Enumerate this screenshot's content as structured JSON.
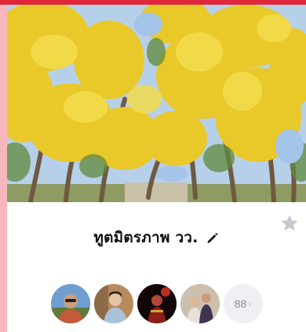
{
  "group": {
    "name": "ทูตมิตรภาพ วว."
  },
  "members": {
    "more_count": "88",
    "more_chevron": "›",
    "avatars": [
      {
        "icon": "member-avatar-man-sunglasses"
      },
      {
        "icon": "member-avatar-woman-indoor"
      },
      {
        "icon": "member-avatar-person-red-light"
      },
      {
        "icon": "member-avatar-couple-outdoor"
      }
    ]
  },
  "icons": {
    "edit": "pencil-icon",
    "favorite": "star-icon"
  },
  "colors": {
    "top_strip": "#e0283a",
    "page_background": "#f7b8bd",
    "star": "#c4c7cc",
    "more_badge_bg": "#eef0f3"
  }
}
